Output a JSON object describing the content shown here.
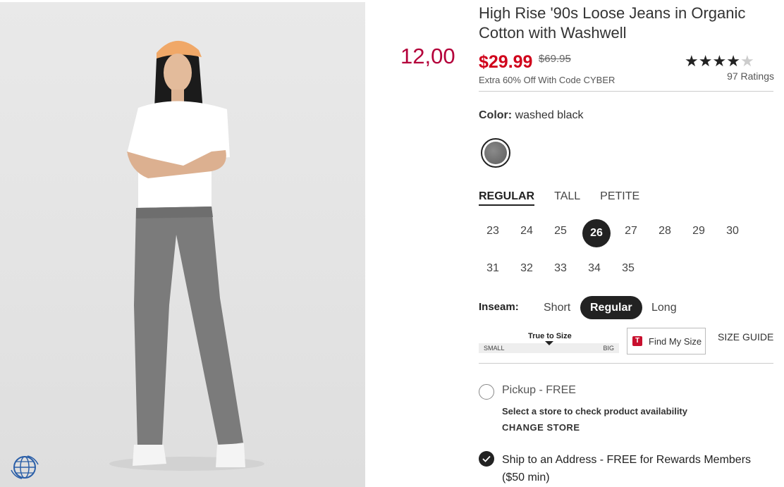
{
  "product": {
    "title": "High Rise '90s Loose Jeans in Organic Cotton with Washwell",
    "sale_price": "$29.99",
    "original_price": "$69.95",
    "promo": "Extra 60% Off With Code CYBER",
    "rating": {
      "value": 4,
      "max": 5,
      "count_label": "97 Ratings"
    }
  },
  "aside_price": "12,00",
  "color": {
    "label": "Color:",
    "value": "washed black"
  },
  "fit_tabs": [
    {
      "label": "REGULAR",
      "active": true
    },
    {
      "label": "TALL",
      "active": false
    },
    {
      "label": "PETITE",
      "active": false
    }
  ],
  "sizes": [
    "23",
    "24",
    "25",
    "26",
    "27",
    "28",
    "29",
    "30",
    "31",
    "32",
    "33",
    "34",
    "35"
  ],
  "selected_size": "26",
  "inseam": {
    "label": "Inseam:",
    "options": [
      "Short",
      "Regular",
      "Long"
    ],
    "selected": "Regular"
  },
  "fit_scale": {
    "label": "True to Size",
    "min_label": "SMALL",
    "max_label": "BIG",
    "position": 0.5
  },
  "find_my_size": {
    "logo": "T",
    "label": "Find My Size"
  },
  "size_guide": "SIZE GUIDE",
  "pickup": {
    "label": "Pickup - FREE",
    "sub": "Select a store to check product availability",
    "change": "CHANGE STORE"
  },
  "ship": {
    "label": "Ship to an Address - FREE for Rewards Members ($50 min)"
  },
  "colors": {
    "sale": "#d0021b",
    "aside": "#b4003a",
    "dark": "#222222"
  }
}
